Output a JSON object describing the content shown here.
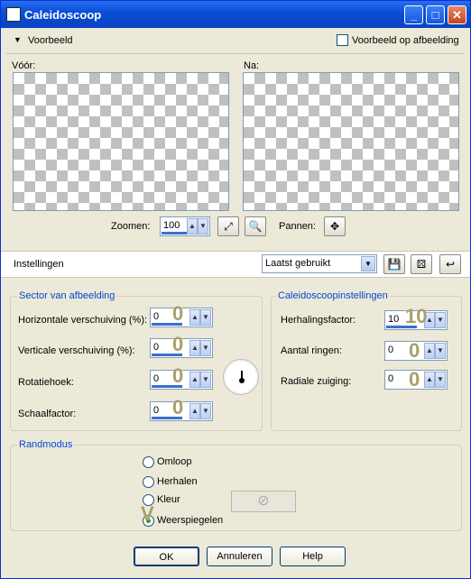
{
  "window": {
    "title": "Caleidoscoop"
  },
  "preview": {
    "section_label": "Voorbeeld",
    "preview_on_image_label": "Voorbeeld op afbeelding",
    "before_label": "Vóór:",
    "after_label": "Na:",
    "zoom_label": "Zoomen:",
    "zoom_value": "100",
    "pan_label": "Pannen:"
  },
  "settings": {
    "label": "Instellingen",
    "preset_value": "Laatst gebruikt"
  },
  "sector": {
    "title": "Sector van afbeelding",
    "fields": [
      {
        "label": "Horizontale verschuiving (%):",
        "value": "0",
        "overlay": "0"
      },
      {
        "label": "Verticale verschuiving (%):",
        "value": "0",
        "overlay": "0"
      },
      {
        "label": "Rotatiehoek:",
        "value": "0",
        "overlay": "0"
      },
      {
        "label": "Schaalfactor:",
        "value": "0",
        "overlay": "0"
      }
    ]
  },
  "kaleido": {
    "title": "Caleidoscoopinstellingen",
    "fields": [
      {
        "label": "Herhalingsfactor:",
        "value": "10",
        "overlay": "10"
      },
      {
        "label": "Aantal ringen:",
        "value": "0",
        "overlay": "0"
      },
      {
        "label": "Radiale zuiging:",
        "value": "0",
        "overlay": "0"
      }
    ]
  },
  "edge": {
    "title": "Randmodus",
    "options": [
      "Omloop",
      "Herhalen",
      "Kleur",
      "Weerspiegelen"
    ],
    "selected": "Weerspiegelen",
    "overlay": "V"
  },
  "buttons": {
    "ok": "OK",
    "cancel": "Annuleren",
    "help": "Help"
  }
}
